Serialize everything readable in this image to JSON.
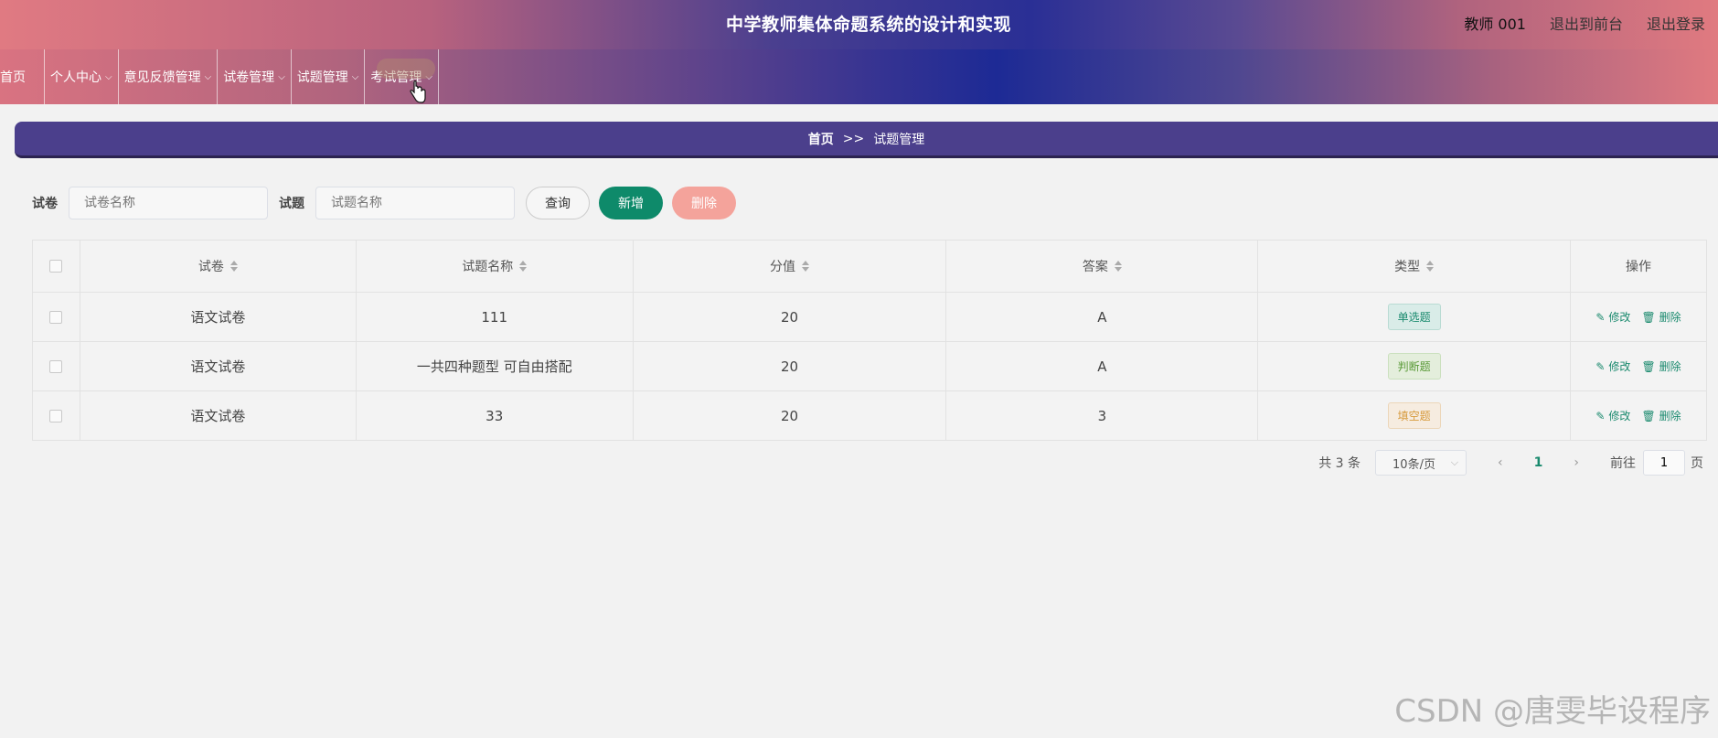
{
  "header": {
    "title": "中学教师集体命题系统的设计和实现",
    "user": "教师 001",
    "links": [
      "退出到前台",
      "退出登录"
    ]
  },
  "nav": {
    "items": [
      "首页",
      "个人中心",
      "意见反馈管理",
      "试卷管理",
      "试题管理",
      "考试管理"
    ]
  },
  "breadcrumb": {
    "home": "首页",
    "separator": ">>",
    "current": "试题管理"
  },
  "search": {
    "paper_label": "试卷",
    "paper_placeholder": "试卷名称",
    "question_label": "试题",
    "question_placeholder": "试题名称",
    "query_label": "查询",
    "add_label": "新增",
    "delete_label": "删除"
  },
  "table": {
    "columns": [
      "试卷",
      "试题名称",
      "分值",
      "答案",
      "类型",
      "操作"
    ],
    "rows": [
      {
        "paper": "语文试卷",
        "name": "111",
        "score": "20",
        "answer": "A",
        "type": "单选题"
      },
      {
        "paper": "语文试卷",
        "name": "一共四种题型 可自由搭配",
        "score": "20",
        "answer": "A",
        "type": "判断题"
      },
      {
        "paper": "语文试卷",
        "name": "33",
        "score": "20",
        "answer": "3",
        "type": "填空题"
      }
    ],
    "edit_label": "修改",
    "delete_label": "删除"
  },
  "pager": {
    "total": "共 3 条",
    "page_size": "10条/页",
    "current_page": "1",
    "goto_label": "前往",
    "goto_value": "1",
    "page_suffix": "页"
  },
  "watermark": "CSDN @唐雯毕设程序",
  "colors": {
    "accent": "#0e8a6a",
    "breadcrumb_bg": "#4b3f8c",
    "delete_button": "#f4a39b"
  }
}
